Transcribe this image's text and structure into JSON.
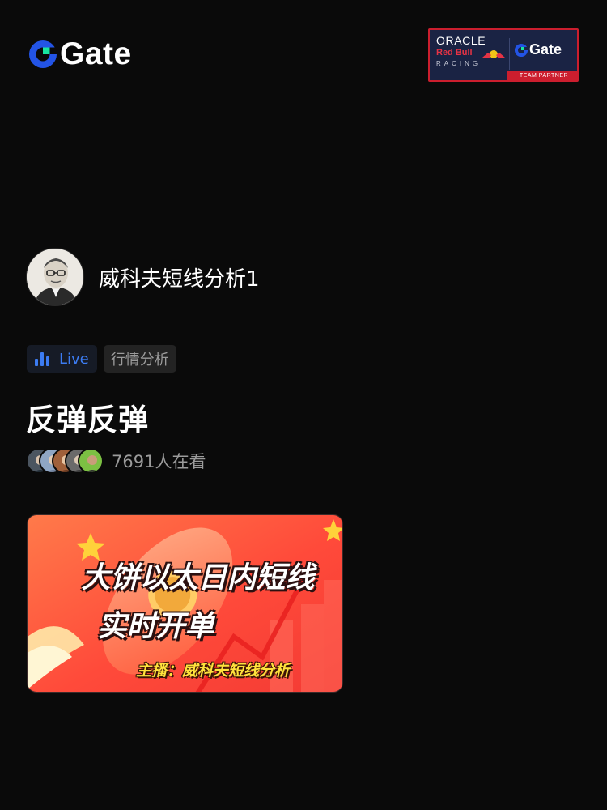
{
  "header": {
    "logo_text": "Gate",
    "partner": {
      "oracle": "ORACLE",
      "redbull": "Red Bull",
      "racing": "RACING",
      "gate": "Gate",
      "strip": "TEAM PARTNER"
    }
  },
  "host": {
    "name": "威科夫短线分析1"
  },
  "tags": {
    "live_label": "Live",
    "category": "行情分析"
  },
  "stream": {
    "title": "反弹反弹",
    "viewer_count_text": "7691人在看"
  },
  "cover": {
    "line1": "大饼以太日内短线",
    "line2": "实时开单",
    "host_line": "主播：威科夫短线分析"
  },
  "colors": {
    "background": "#0a0a0a",
    "accent_blue": "#3c7cf2",
    "logo_green": "#17e6a1",
    "partner_red": "#cc1e2e"
  }
}
